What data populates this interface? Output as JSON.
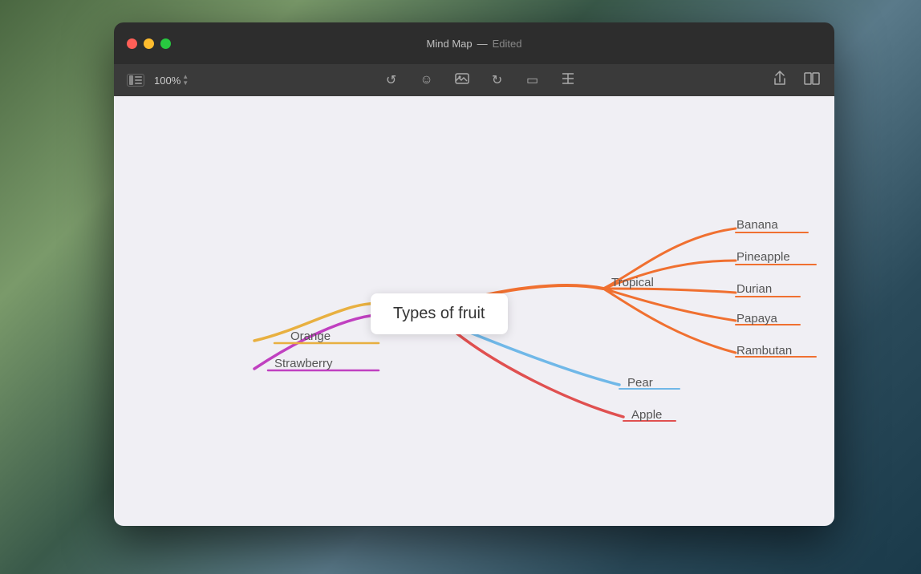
{
  "desktop": {
    "bg_color": "#5a7a6a"
  },
  "window": {
    "title": "Mind Map",
    "separator": "—",
    "status": "Edited"
  },
  "toolbar": {
    "zoom": "100%",
    "sidebar_icon": "▦",
    "icons": [
      "↺",
      "☺",
      "⊞",
      "↻",
      "▭",
      "✕✕"
    ]
  },
  "mindmap": {
    "center": "Types of fruit",
    "branches": {
      "orange": {
        "label": "Orange",
        "color": "#e8b040"
      },
      "strawberry": {
        "label": "Strawberry",
        "color": "#c040c0"
      },
      "tropical": {
        "label": "Tropical",
        "color": "#f07030",
        "children": [
          {
            "label": "Banana",
            "color": "#f07030"
          },
          {
            "label": "Pineapple",
            "color": "#f07030"
          },
          {
            "label": "Durian",
            "color": "#f07030"
          },
          {
            "label": "Papaya",
            "color": "#f07030"
          },
          {
            "label": "Rambutan",
            "color": "#f07030"
          }
        ]
      },
      "pear": {
        "label": "Pear",
        "color": "#70b8e8"
      },
      "apple": {
        "label": "Apple",
        "color": "#e05050"
      }
    }
  }
}
